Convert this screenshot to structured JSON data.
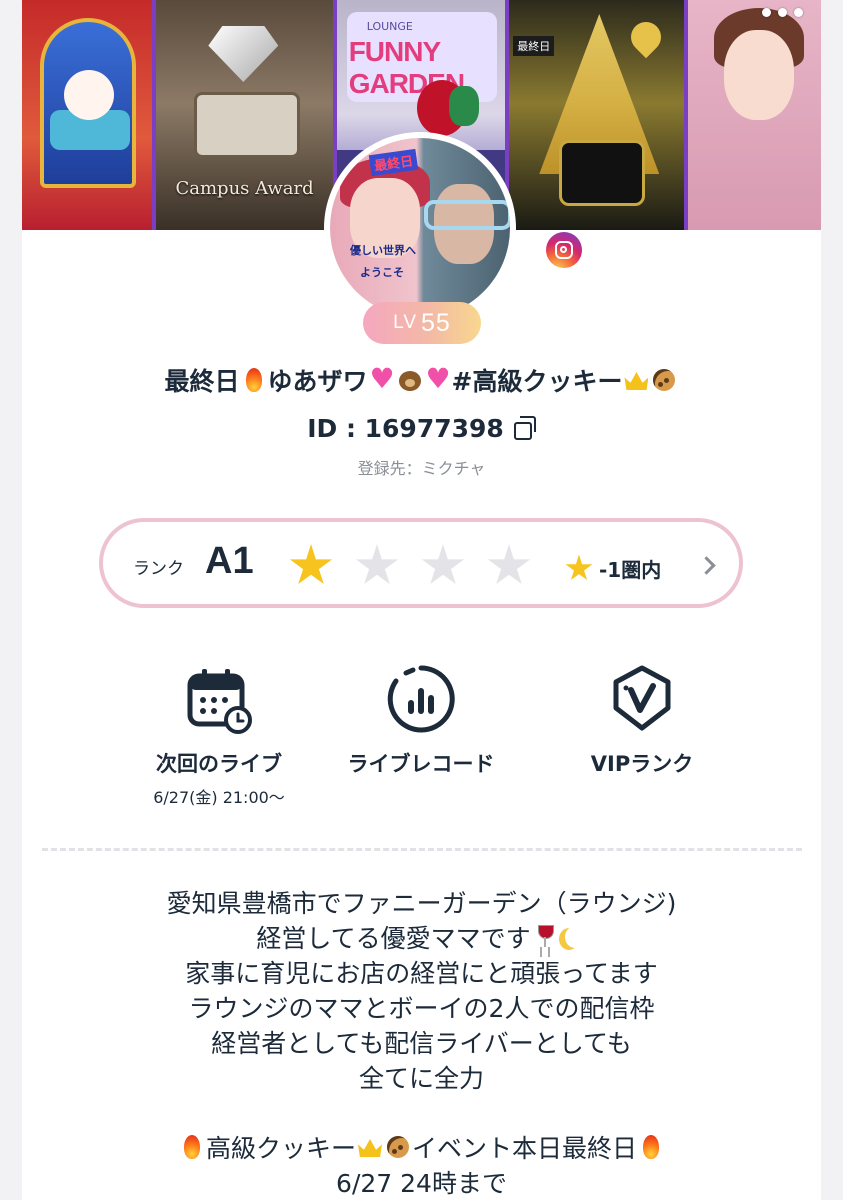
{
  "profile": {
    "name_parts": [
      "最終日",
      "ゆあザワ",
      "#高級クッキー"
    ],
    "id_text": "ID : 16977398",
    "registered": "登録先：ミクチャ",
    "level_prefix": "LV",
    "level_number": "55"
  },
  "banner": {
    "panel2_caption": "Campus Award",
    "panel3_small": "LOUNGE",
    "panel3_title": "FUNNY GARDEN",
    "panel4_tag": "最終日",
    "avatar_tag": "最終日",
    "avatar_text1": "優しい世界へ",
    "avatar_text2": "ようこそ"
  },
  "rank": {
    "label": "ランク",
    "value": "A1",
    "stars_filled": 1,
    "stars_total": 4,
    "zone": "-1圏内"
  },
  "actions": {
    "next_live": {
      "label": "次回のライブ",
      "sub": "6/27(金) 21:00〜"
    },
    "live_record": {
      "label": "ライブレコード"
    },
    "vip_rank": {
      "label": "VIPランク"
    }
  },
  "bio": {
    "lines": [
      "愛知県豊橋市でファニーガーデン（ラウンジ)",
      "経営してる優愛ママです",
      "家事に育児にお店の経営にと頑張ってます",
      "ラウンジのママとボーイの2人での配信枠",
      "経営者としても配信ライバーとしても",
      "全てに全力",
      "高級クッキー",
      "イベント本日最終日",
      "6/27 24時まで"
    ]
  },
  "colors": {
    "text": "#1c2a3a",
    "muted": "#8a8e96",
    "star": "#f7c31f",
    "rank_border": "#eec3d1",
    "level_gradient_start": "#f5a7c0",
    "level_gradient_end": "#f8d78e"
  },
  "icons": [
    "more-dots-icon",
    "instagram-icon",
    "copy-icon",
    "star-icon",
    "chevron-right-icon",
    "calendar-clock-icon",
    "live-record-icon",
    "vip-badge-icon"
  ]
}
